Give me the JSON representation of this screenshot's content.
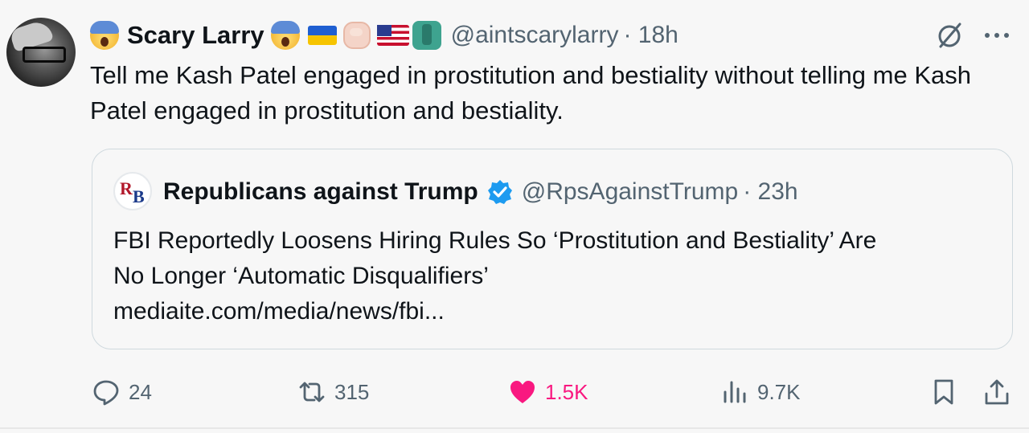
{
  "author": {
    "display_name": "Scary Larry",
    "handle": "@aintscarylarry",
    "time": "· 18h"
  },
  "tweet": {
    "text": "Tell me Kash Patel engaged in prostitution and bestiality without telling me Kash Patel engaged in prostitution and bestiality."
  },
  "quote": {
    "display_name": "Republicans against Trump",
    "handle": "@RpsAgainstTrump",
    "time": "· 23h",
    "text_line1": "FBI Reportedly Loosens Hiring Rules So ‘Prostitution and Bestiality’ Are",
    "text_line2": "No Longer ‘Automatic Disqualifiers’",
    "link": "mediaite.com/media/news/fbi..."
  },
  "actions": {
    "replies": "24",
    "reposts": "315",
    "likes": "1.5K",
    "views": "9.7K"
  },
  "icons": {
    "header": [
      "screaming-face-emoji",
      "ukraine-flag-emoji",
      "raised-fist-emoji",
      "us-flag-emoji",
      "statue-of-liberty-emoji",
      "screaming-face-emoji"
    ],
    "grok": "grok-icon",
    "more": "more-icon",
    "verified": "verified-badge-icon",
    "reply": "reply-icon",
    "repost": "repost-icon",
    "like": "heart-icon",
    "views": "views-icon",
    "bookmark": "bookmark-icon",
    "share": "share-icon"
  },
  "colors": {
    "text": "#0f1419",
    "secondary": "#536471",
    "like": "#f91880",
    "verified": "#1d9bf0",
    "border": "#cfd9de"
  }
}
